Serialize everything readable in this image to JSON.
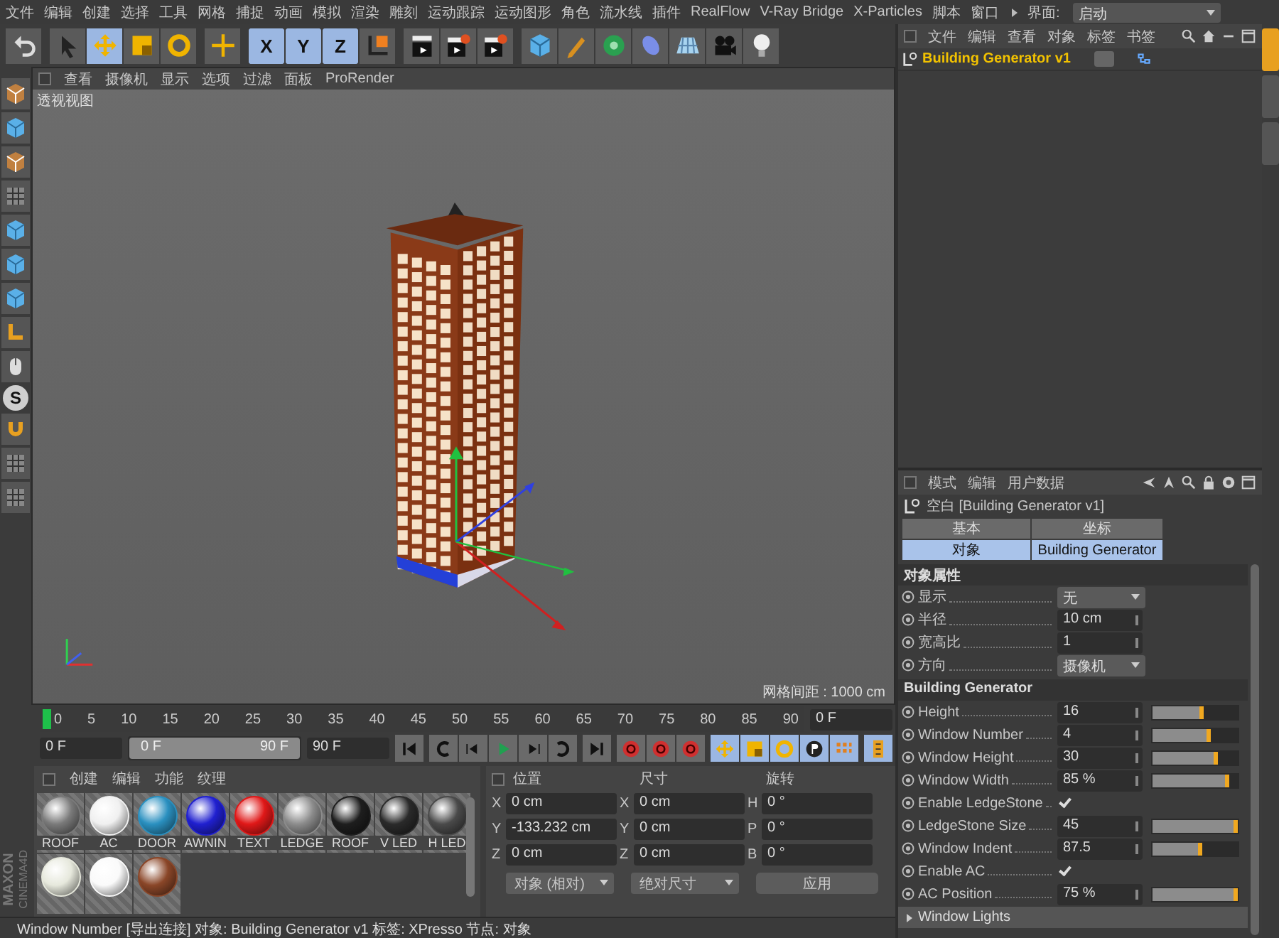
{
  "menu_bar": {
    "items": [
      "文件",
      "编辑",
      "创建",
      "选择",
      "工具",
      "网格",
      "捕捉",
      "动画",
      "模拟",
      "渲染",
      "雕刻",
      "运动跟踪",
      "运动图形",
      "角色",
      "流水线",
      "插件",
      "RealFlow",
      "V-Ray Bridge",
      "X-Particles",
      "脚本",
      "窗口"
    ],
    "layout_label": "界面:",
    "layout_value": "启动"
  },
  "toolbar": [
    [
      {
        "kind": "undo",
        "selected": false
      }
    ],
    [
      {
        "kind": "cursor",
        "selected": false
      },
      {
        "kind": "move",
        "selected": true
      },
      {
        "kind": "scale",
        "selected": false
      },
      {
        "kind": "rotate",
        "selected": false
      }
    ],
    [
      {
        "kind": "add",
        "selected": false
      }
    ],
    [
      {
        "kind": "axis",
        "label": "X",
        "selected": true
      },
      {
        "kind": "axis",
        "label": "Y",
        "selected": true
      },
      {
        "kind": "axis",
        "label": "Z",
        "selected": true
      },
      {
        "kind": "coords",
        "selected": false
      }
    ],
    [
      {
        "kind": "clapper",
        "selected": false
      },
      {
        "kind": "clapper2",
        "selected": false
      },
      {
        "kind": "clapper2",
        "selected": false
      }
    ],
    [
      {
        "kind": "cube",
        "selected": false
      },
      {
        "kind": "pen",
        "selected": false
      },
      {
        "kind": "gear",
        "selected": false
      },
      {
        "kind": "ellipse",
        "selected": false
      },
      {
        "kind": "plane",
        "selected": false
      },
      {
        "kind": "camera",
        "selected": false
      },
      {
        "kind": "bulb",
        "selected": false
      }
    ]
  ],
  "left_tools": [
    {
      "kind": "checker"
    },
    {
      "kind": "cube"
    },
    {
      "kind": "checker"
    },
    {
      "kind": "grid"
    },
    {
      "kind": "cube"
    },
    {
      "kind": "cube"
    },
    {
      "kind": "cube"
    },
    {
      "kind": "lshape"
    },
    {
      "kind": "mouse"
    },
    {
      "kind": "letter",
      "label": "S"
    },
    {
      "kind": "magnet"
    },
    {
      "kind": "grid"
    },
    {
      "kind": "grid"
    }
  ],
  "logo": [
    "MAXON",
    "CINEMA4D"
  ],
  "viewport": {
    "menu": [
      "查看",
      "摄像机",
      "显示",
      "选项",
      "过滤",
      "面板",
      "ProRender"
    ],
    "view_label": "透视视图",
    "grid_spacing": "网格间距 : 1000 cm"
  },
  "timeline": {
    "ticks": [
      "0",
      "5",
      "10",
      "15",
      "20",
      "25",
      "30",
      "35",
      "40",
      "45",
      "50",
      "55",
      "60",
      "65",
      "70",
      "75",
      "80",
      "85",
      "90"
    ],
    "current_frame": "0 F"
  },
  "playback": {
    "start": "0 F",
    "range_start": "0 F",
    "range_end": "90 F",
    "level": 1,
    "end": "90 F"
  },
  "side_tabs": [
    {
      "selected": true
    },
    {
      "selected": false
    },
    {
      "selected": false
    }
  ],
  "materials": {
    "menu": [
      "创建",
      "编辑",
      "功能",
      "纹理"
    ],
    "items": [
      {
        "name": "ROOF",
        "color": "#7a7a7a"
      },
      {
        "name": "AC",
        "color": "#f0f0f0"
      },
      {
        "name": "DOOR",
        "color": "#2a90c0"
      },
      {
        "name": "AWNIN",
        "color": "#2020d0"
      },
      {
        "name": "TEXT",
        "color": "#e01818"
      },
      {
        "name": "LEDGE",
        "color": "#8c8c8c"
      },
      {
        "name": "ROOF",
        "color": "#1e1e1e"
      },
      {
        "name": "V LED",
        "color": "#2a2a2a"
      },
      {
        "name": "H LED",
        "color": "#4a4a4a"
      },
      {
        "color": "#e6e8dc"
      },
      {
        "color": "#fafafa"
      },
      {
        "color": "#8a4628"
      }
    ]
  },
  "coordinates": {
    "headers": [
      "位置",
      "尺寸",
      "旋转"
    ],
    "rows": [
      [
        {
          "axis": "X",
          "value": "0 cm"
        },
        {
          "axis": "X",
          "value": "0 cm"
        },
        {
          "axis": "H",
          "value": "0 °"
        }
      ],
      [
        {
          "axis": "Y",
          "value": "-133.232 cm"
        },
        {
          "axis": "Y",
          "value": "0 cm"
        },
        {
          "axis": "P",
          "value": "0 °"
        }
      ],
      [
        {
          "axis": "Z",
          "value": "0 cm"
        },
        {
          "axis": "Z",
          "value": "0 cm"
        },
        {
          "axis": "B",
          "value": "0 °"
        }
      ]
    ],
    "dropdowns": [
      "对象 (相对)",
      "绝对尺寸"
    ],
    "apply": "应用"
  },
  "status_bar": "Window Number [导出连接] 对象: Building Generator v1 标签: XPresso 节点: 对象",
  "object_manager": {
    "menu": [
      "文件",
      "编辑",
      "查看",
      "对象",
      "标签",
      "书签"
    ],
    "objects": [
      {
        "name": "Building Generator v1",
        "selected": false
      }
    ]
  },
  "attributes": {
    "menu": [
      "模式",
      "编辑",
      "用户数据"
    ],
    "title": "空白 [Building Generator v1]",
    "tabs": [
      {
        "label": "基本",
        "selected": false
      },
      {
        "label": "坐标",
        "selected": false
      },
      {
        "label": "对象",
        "selected": true
      },
      {
        "label": "Building Generator",
        "selected": true
      }
    ],
    "sections": [
      {
        "title": "对象属性",
        "params": [
          {
            "kind": "dropdown",
            "label": "显示",
            "value": "无"
          },
          {
            "kind": "number",
            "label": "半径",
            "value": "10 cm"
          },
          {
            "kind": "number",
            "label": "宽高比",
            "value": "1"
          },
          {
            "kind": "dropdown",
            "label": "方向",
            "value": "摄像机"
          }
        ]
      },
      {
        "title": "Building Generator",
        "params": [
          {
            "kind": "slider",
            "label": "Height",
            "value": "16",
            "level": 0.6
          },
          {
            "kind": "slider",
            "label": "Window Number",
            "value": "4",
            "level": 0.68
          },
          {
            "kind": "slider",
            "label": "Window Height",
            "value": "30",
            "level": 0.76
          },
          {
            "kind": "slider",
            "label": "Window Width",
            "value": "85 %",
            "level": 0.9
          },
          {
            "kind": "check",
            "label": "Enable LedgeStone",
            "checked": true
          },
          {
            "kind": "slider",
            "label": "LedgeStone Size",
            "value": "45",
            "level": 1
          },
          {
            "kind": "slider",
            "label": "Window Indent",
            "value": "87.5",
            "level": 0.58
          },
          {
            "kind": "check",
            "label": "Enable AC",
            "checked": true
          },
          {
            "kind": "slider",
            "label": "AC Position",
            "value": "75 %",
            "level": 1
          }
        ]
      }
    ],
    "groups": [
      {
        "title": "Window Lights",
        "expanded": false
      }
    ]
  }
}
